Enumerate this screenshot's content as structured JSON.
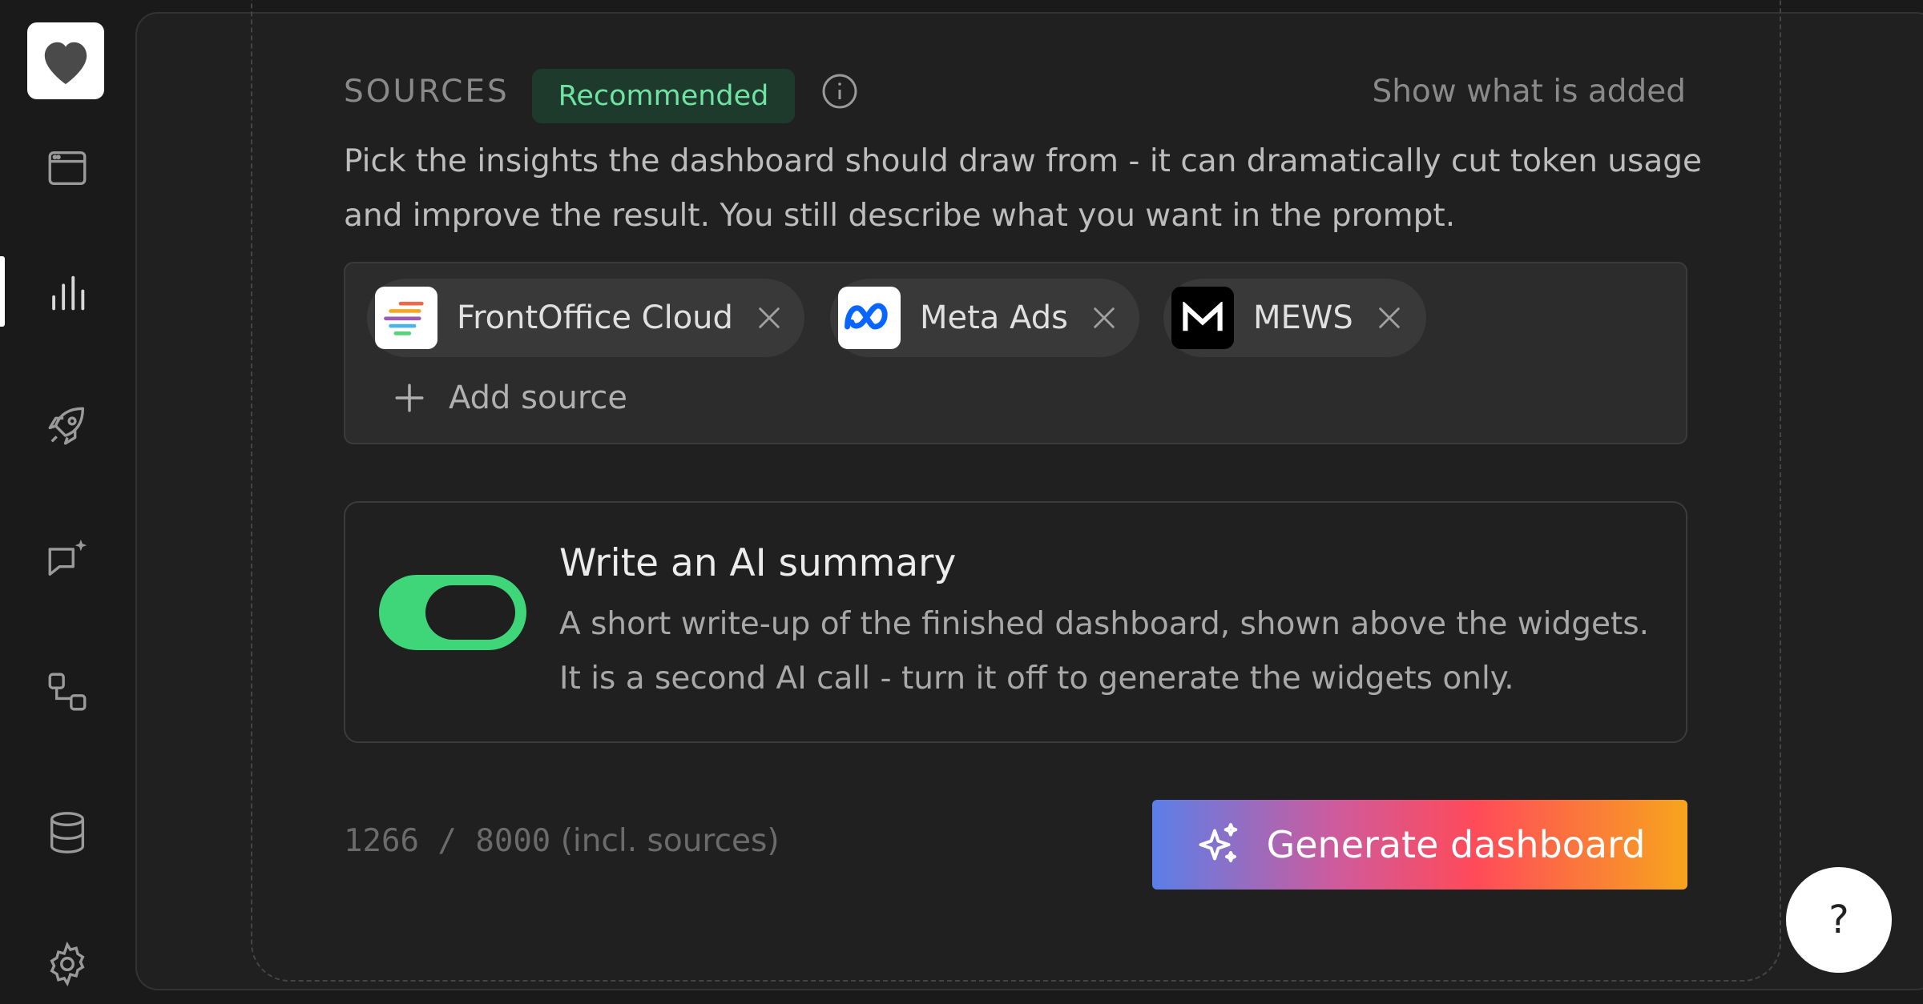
{
  "sidebar": {
    "items": [
      {
        "icon": "browser-window-icon"
      },
      {
        "icon": "bar-chart-icon",
        "active": true
      },
      {
        "icon": "rocket-icon"
      },
      {
        "icon": "chat-sparkle-icon"
      },
      {
        "icon": "workflow-icon"
      },
      {
        "icon": "database-icon"
      },
      {
        "icon": "gear-icon"
      }
    ],
    "logo_icon": "heart-icon"
  },
  "sources": {
    "title": "SOURCES",
    "badge": "Recommended",
    "show_added_link": "Show what is added",
    "description": "Pick the insights the dashboard should draw from - it can dramatically cut token usage and improve the result. You still describe what you want in the prompt.",
    "chips": [
      {
        "label": "FrontOffice Cloud",
        "icon": "frontoffice-cloud-logo"
      },
      {
        "label": "Meta Ads",
        "icon": "meta-logo"
      },
      {
        "label": "MEWS",
        "icon": "mews-logo"
      }
    ],
    "add_source_label": "Add source"
  },
  "summary": {
    "enabled": true,
    "title": "Write an AI summary",
    "description": "A short write-up of the finished dashboard, shown above the widgets. It is a second AI call - turn it off to generate the widgets only."
  },
  "footer": {
    "count": "1266 / 8000",
    "count_suffix": "(incl. sources)",
    "generate_label": "Generate dashboard"
  },
  "help": {
    "label": "?"
  },
  "colors": {
    "accent_green": "#3fd67a",
    "badge_text": "#6fe3a2",
    "gradient": [
      "#5b7fe8",
      "#ff4a5a",
      "#f7a41d"
    ]
  }
}
